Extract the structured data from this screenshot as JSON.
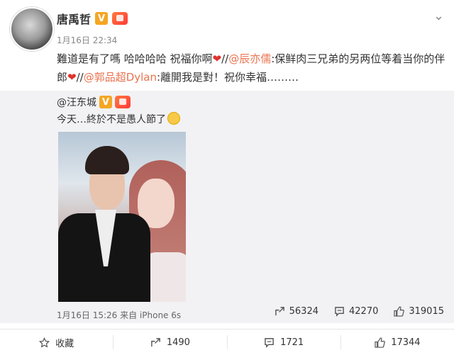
{
  "post": {
    "author": "唐禹哲",
    "verified_badge": "V",
    "timestamp": "1月16日 22:34",
    "text_part1": "難道是有了嗎 哈哈哈哈 祝福你啊",
    "sep1": "//",
    "mention1": "@辰亦儒",
    "text_part2": ":保鲜肉三兄弟的另两位等着当你的伴郎",
    "sep2": "//",
    "mention2": "@郭品超Dylan",
    "text_part3": ":離開我是對！祝你幸福………"
  },
  "quoted": {
    "author": "@汪东城",
    "verified_badge": "V",
    "text": "今天…終於不是愚人節了",
    "meta": "1月16日 15:26 来自 iPhone 6s",
    "reposts": "56324",
    "comments": "42270",
    "likes": "319015"
  },
  "actions": {
    "favorite": "收藏",
    "repost": "1490",
    "comment": "1721",
    "like": "17344"
  },
  "colors": {
    "mention": "#eb7350",
    "verified": "#f5a623",
    "quote_bg": "#f2f2f5"
  },
  "icons": [
    "chevron-down-icon",
    "verified-icon",
    "level-icon",
    "share-icon",
    "comment-icon",
    "like-icon",
    "star-icon",
    "smile-emoji-icon",
    "heart-emoji-icon"
  ]
}
